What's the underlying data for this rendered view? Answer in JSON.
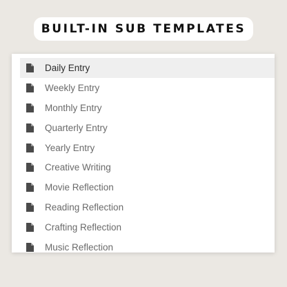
{
  "header": {
    "title": "BUILT-IN SUB TEMPLATES"
  },
  "templates": {
    "icon": "document-icon",
    "items": [
      {
        "label": "Daily Entry",
        "selected": true
      },
      {
        "label": "Weekly Entry",
        "selected": false
      },
      {
        "label": "Monthly Entry",
        "selected": false
      },
      {
        "label": "Quarterly Entry",
        "selected": false
      },
      {
        "label": "Yearly Entry",
        "selected": false
      },
      {
        "label": "Creative Writing",
        "selected": false
      },
      {
        "label": "Movie Reflection",
        "selected": false
      },
      {
        "label": "Reading Reflection",
        "selected": false
      },
      {
        "label": "Crafting Reflection",
        "selected": false
      },
      {
        "label": "Music Reflection",
        "selected": false
      }
    ]
  },
  "colors": {
    "background": "#ebe8e3",
    "selected_row": "#efefef",
    "icon": "#4a4a4a",
    "label": "#6a6a6a"
  }
}
